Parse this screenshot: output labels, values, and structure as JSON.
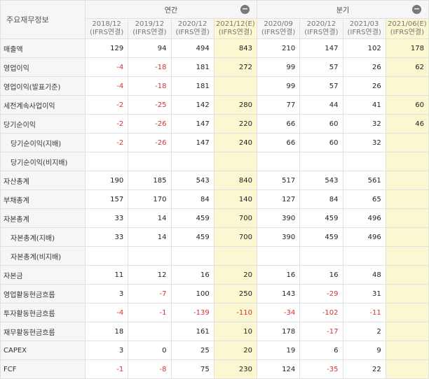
{
  "header": {
    "corner_label": "주요재무정보",
    "annual_label": "연간",
    "quarter_label": "분기",
    "collapse_glyph": "−",
    "annual_periods": [
      {
        "period": "2018/12",
        "basis": "(IFRS연결)",
        "estimate": false
      },
      {
        "period": "2019/12",
        "basis": "(IFRS연결)",
        "estimate": false
      },
      {
        "period": "2020/12",
        "basis": "(IFRS연결)",
        "estimate": false
      },
      {
        "period": "2021/12(E)",
        "basis": "(IFRS연결)",
        "estimate": true
      }
    ],
    "quarter_periods": [
      {
        "period": "2020/09",
        "basis": "(IFRS연결)",
        "estimate": false
      },
      {
        "period": "2020/12",
        "basis": "(IFRS연결)",
        "estimate": false
      },
      {
        "period": "2021/03",
        "basis": "(IFRS연결)",
        "estimate": false
      },
      {
        "period": "2021/06(E)",
        "basis": "(IFRS연결)",
        "estimate": true
      }
    ]
  },
  "rows": [
    {
      "label": "매출액",
      "sub": false,
      "values": [
        "129",
        "94",
        "494",
        "843",
        "210",
        "147",
        "102",
        "178"
      ]
    },
    {
      "label": "영업이익",
      "sub": false,
      "values": [
        "-4",
        "-18",
        "181",
        "272",
        "99",
        "57",
        "26",
        "62"
      ]
    },
    {
      "label": "영업이익(발표기준)",
      "sub": false,
      "values": [
        "-4",
        "-18",
        "181",
        "",
        "99",
        "57",
        "26",
        ""
      ]
    },
    {
      "label": "세전계속사업이익",
      "sub": false,
      "values": [
        "-2",
        "-25",
        "142",
        "280",
        "77",
        "44",
        "41",
        "60"
      ]
    },
    {
      "label": "당기순이익",
      "sub": false,
      "values": [
        "-2",
        "-26",
        "147",
        "220",
        "66",
        "60",
        "32",
        "46"
      ]
    },
    {
      "label": "당기순이익(지배)",
      "sub": true,
      "values": [
        "-2",
        "-26",
        "147",
        "240",
        "66",
        "60",
        "32",
        ""
      ]
    },
    {
      "label": "당기순이익(비지배)",
      "sub": true,
      "values": [
        "",
        "",
        "",
        "",
        "",
        "",
        "",
        ""
      ]
    },
    {
      "label": "자산총계",
      "sub": false,
      "values": [
        "190",
        "185",
        "543",
        "840",
        "517",
        "543",
        "561",
        ""
      ]
    },
    {
      "label": "부채총계",
      "sub": false,
      "values": [
        "157",
        "170",
        "84",
        "140",
        "127",
        "84",
        "65",
        ""
      ]
    },
    {
      "label": "자본총계",
      "sub": false,
      "values": [
        "33",
        "14",
        "459",
        "700",
        "390",
        "459",
        "496",
        ""
      ]
    },
    {
      "label": "자본총계(지배)",
      "sub": true,
      "values": [
        "33",
        "14",
        "459",
        "700",
        "390",
        "459",
        "496",
        ""
      ]
    },
    {
      "label": "자본총계(비지배)",
      "sub": true,
      "values": [
        "",
        "",
        "",
        "",
        "",
        "",
        "",
        ""
      ]
    },
    {
      "label": "자본금",
      "sub": false,
      "values": [
        "11",
        "12",
        "16",
        "20",
        "16",
        "16",
        "48",
        ""
      ]
    },
    {
      "label": "영업활동현금흐름",
      "sub": false,
      "values": [
        "3",
        "-7",
        "100",
        "250",
        "143",
        "-29",
        "31",
        ""
      ]
    },
    {
      "label": "투자활동현금흐름",
      "sub": false,
      "values": [
        "-4",
        "-1",
        "-139",
        "-110",
        "-34",
        "-102",
        "-11",
        ""
      ]
    },
    {
      "label": "재무활동현금흐름",
      "sub": false,
      "values": [
        "18",
        "",
        "161",
        "10",
        "178",
        "-17",
        "2",
        ""
      ]
    },
    {
      "label": "CAPEX",
      "sub": false,
      "values": [
        "3",
        "0",
        "25",
        "20",
        "19",
        "6",
        "9",
        ""
      ]
    },
    {
      "label": "FCF",
      "sub": false,
      "values": [
        "-1",
        "-8",
        "75",
        "230",
        "124",
        "-35",
        "22",
        ""
      ]
    }
  ]
}
